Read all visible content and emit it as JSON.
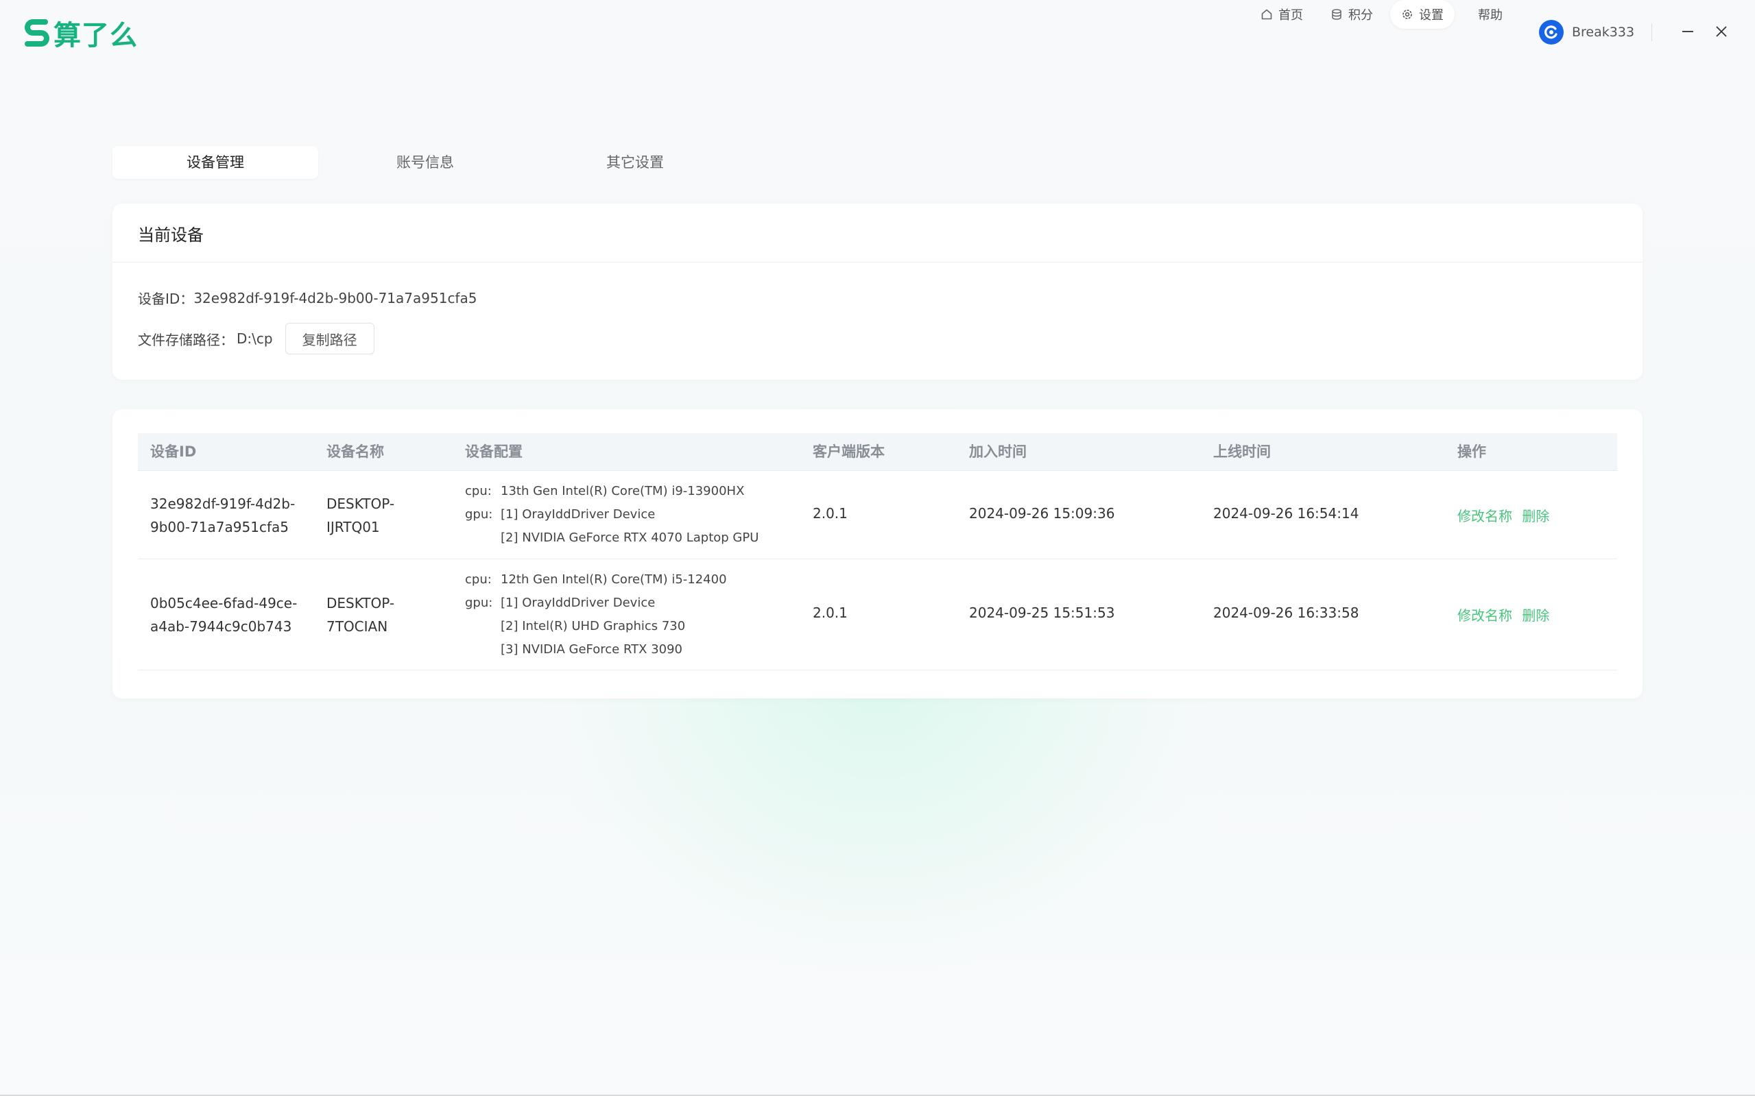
{
  "app": {
    "brand": "算了么",
    "brand_color": "#17b27f",
    "accent_color": "#46c67c"
  },
  "nav": {
    "home": "首页",
    "points": "积分",
    "settings": "设置",
    "help": "帮助",
    "username": "Break333"
  },
  "tabs": [
    {
      "label": "设备管理",
      "active": true
    },
    {
      "label": "账号信息",
      "active": false
    },
    {
      "label": "其它设置",
      "active": false
    }
  ],
  "current_device": {
    "title": "当前设备",
    "id_label": "设备ID：",
    "id_value": "32e982df-919f-4d2b-9b00-71a7a951cfa5",
    "path_label": "文件存储路径：",
    "path_value": "D:\\cp",
    "copy_button": "复制路径"
  },
  "table": {
    "headers": {
      "id": "设备ID",
      "name": "设备名称",
      "config": "设备配置",
      "version": "客户端版本",
      "joined": "加入时间",
      "online": "上线时间",
      "actions": "操作"
    },
    "rows": [
      {
        "id_line1": "32e982df-919f-4d2b-",
        "id_line2": "9b00-71a7a951cfa5",
        "name_line1": "DESKTOP-",
        "name_line2": "IJRTQ01",
        "cpu_label": "cpu:",
        "cpu": "13th Gen Intel(R) Core(TM) i9-13900HX",
        "gpu_label": "gpu:",
        "gpus": [
          "[1] OrayIddDriver Device",
          "[2] NVIDIA GeForce RTX 4070 Laptop GPU"
        ],
        "version": "2.0.1",
        "joined": "2024-09-26 15:09:36",
        "online": "2024-09-26 16:54:14",
        "rename": "修改名称",
        "delete": "删除"
      },
      {
        "id_line1": "0b05c4ee-6fad-49ce-",
        "id_line2": "a4ab-7944c9c0b743",
        "name_line1": "DESKTOP-",
        "name_line2": "7TOCIAN",
        "cpu_label": "cpu:",
        "cpu": "12th Gen Intel(R) Core(TM) i5-12400",
        "gpu_label": "gpu:",
        "gpus": [
          "[1] OrayIddDriver Device",
          "[2] Intel(R) UHD Graphics 730",
          "[3] NVIDIA GeForce RTX 3090"
        ],
        "version": "2.0.1",
        "joined": "2024-09-25 15:51:53",
        "online": "2024-09-26 16:33:58",
        "rename": "修改名称",
        "delete": "删除"
      }
    ]
  }
}
